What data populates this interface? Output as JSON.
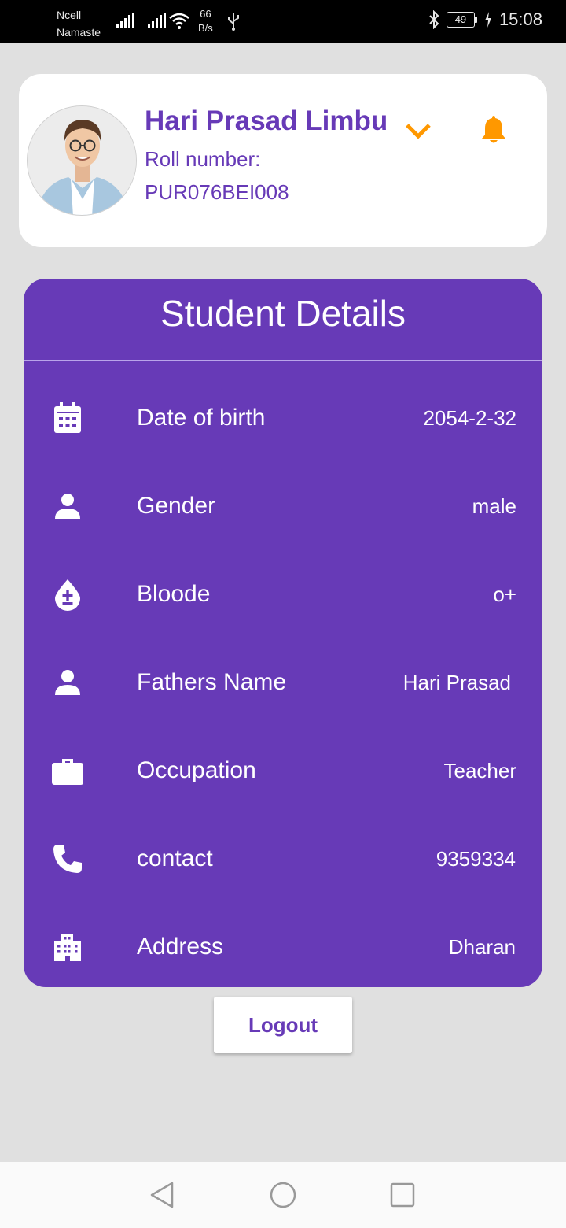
{
  "status_bar": {
    "carrier_line1": "Ncell",
    "carrier_line2": "Namaste",
    "net_speed_value": "66",
    "net_speed_unit": "B/s",
    "battery": "49",
    "time": "15:08"
  },
  "profile": {
    "name": "Hari Prasad Limbu",
    "roll_label": "Roll number:",
    "roll_value": "PUR076BEI008",
    "avatar_icon": "profile-photo",
    "dropdown_icon": "chevron-down-icon",
    "notification_icon": "bell-icon"
  },
  "details": {
    "title": "Student Details",
    "rows": [
      {
        "icon": "calendar-icon",
        "label": "Date of birth",
        "value": "2054-2-32"
      },
      {
        "icon": "person-icon",
        "label": "Gender",
        "value": "male"
      },
      {
        "icon": "blood-drop-icon",
        "label": "Bloode",
        "value": "o+"
      },
      {
        "icon": "person-icon",
        "label": "Fathers Name",
        "value": "Hari Prasad"
      },
      {
        "icon": "briefcase-icon",
        "label": "Occupation",
        "value": "Teacher"
      },
      {
        "icon": "phone-icon",
        "label": "contact",
        "value": "9359334"
      },
      {
        "icon": "building-icon",
        "label": "Address",
        "value": "Dharan"
      }
    ]
  },
  "logout_label": "Logout",
  "colors": {
    "primary": "#673ab7",
    "accent": "#ff9800",
    "background": "#e0e0e0"
  }
}
